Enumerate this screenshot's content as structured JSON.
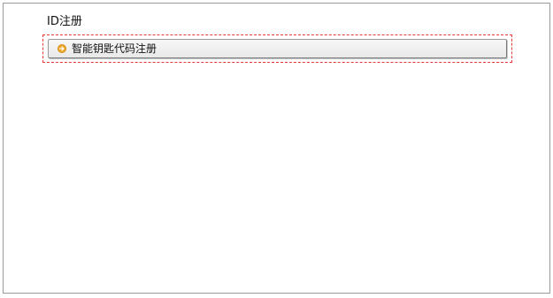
{
  "section": {
    "title": "ID注册"
  },
  "register_button": {
    "label": "智能钥匙代码注册",
    "icon": "arrow-right-circle-icon",
    "icon_color": "#f0a82a"
  },
  "colors": {
    "focus_outline": "#e53935",
    "panel_border": "#9a9a9a"
  }
}
